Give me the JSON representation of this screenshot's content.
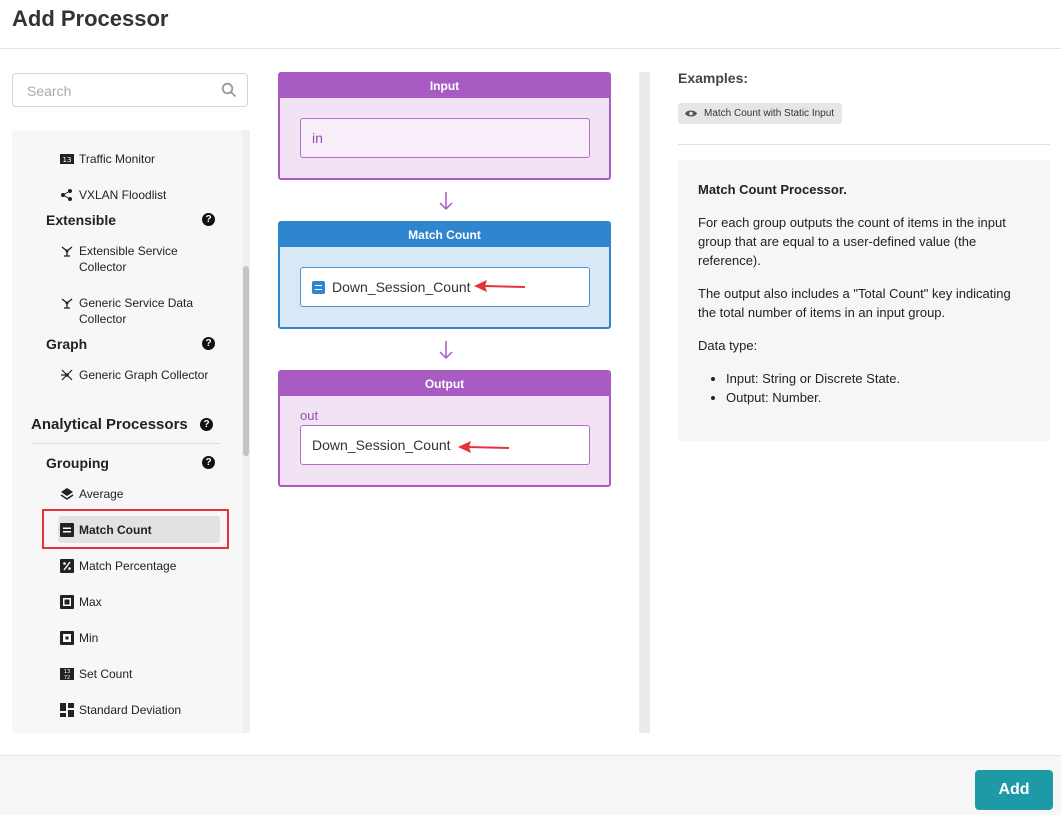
{
  "page": {
    "title": "Add Processor"
  },
  "search": {
    "placeholder": "Search"
  },
  "tree": {
    "items_top": [
      {
        "label": "Traffic Monitor",
        "icon": "counter-icon"
      },
      {
        "label": "VXLAN Floodlist",
        "icon": "network-nodes-icon"
      }
    ],
    "extensible": {
      "title": "Extensible",
      "items": [
        {
          "label": "Extensible Service Collector",
          "icon": "collector-icon"
        },
        {
          "label": "Generic Service Data Collector",
          "icon": "collector-icon"
        }
      ]
    },
    "graph": {
      "title": "Graph",
      "items": [
        {
          "label": "Generic Graph Collector",
          "icon": "graph-nodes-icon"
        }
      ]
    },
    "analytical": {
      "title": "Analytical Processors"
    },
    "grouping": {
      "title": "Grouping",
      "items": [
        {
          "label": "Average",
          "icon": "layers-icon"
        },
        {
          "label": "Match Count",
          "icon": "equals-icon",
          "selected": true
        },
        {
          "label": "Match Percentage",
          "icon": "percent-icon"
        },
        {
          "label": "Max",
          "icon": "max-icon"
        },
        {
          "label": "Min",
          "icon": "min-icon"
        },
        {
          "label": "Set Count",
          "icon": "counter-icon"
        },
        {
          "label": "Standard Deviation",
          "icon": "grid-icon"
        }
      ]
    },
    "help_symbol": "?"
  },
  "canvas": {
    "input": {
      "header": "Input",
      "value": "in"
    },
    "match_count": {
      "header": "Match Count",
      "value": "Down_Session_Count"
    },
    "output": {
      "header": "Output",
      "label": "out",
      "value": "Down_Session_Count"
    },
    "colors": {
      "purple": "#a95bc4",
      "blue": "#2f86cf",
      "arrow_red": "#e5323b"
    }
  },
  "examples": {
    "label": "Examples:",
    "chip": "Match Count with Static Input"
  },
  "description": {
    "title": "Match Count Processor.",
    "p1": "For each group outputs the count of items in the input group that are equal to a user-defined value (the reference).",
    "p2": "The output also includes a \"Total Count\" key indicating the total number of items in an input group.",
    "p3": "Data type:",
    "bullets": [
      "Input: String or Discrete State.",
      "Output: Number."
    ]
  },
  "footer": {
    "add_label": "Add",
    "accent": "#1e9aa6"
  }
}
